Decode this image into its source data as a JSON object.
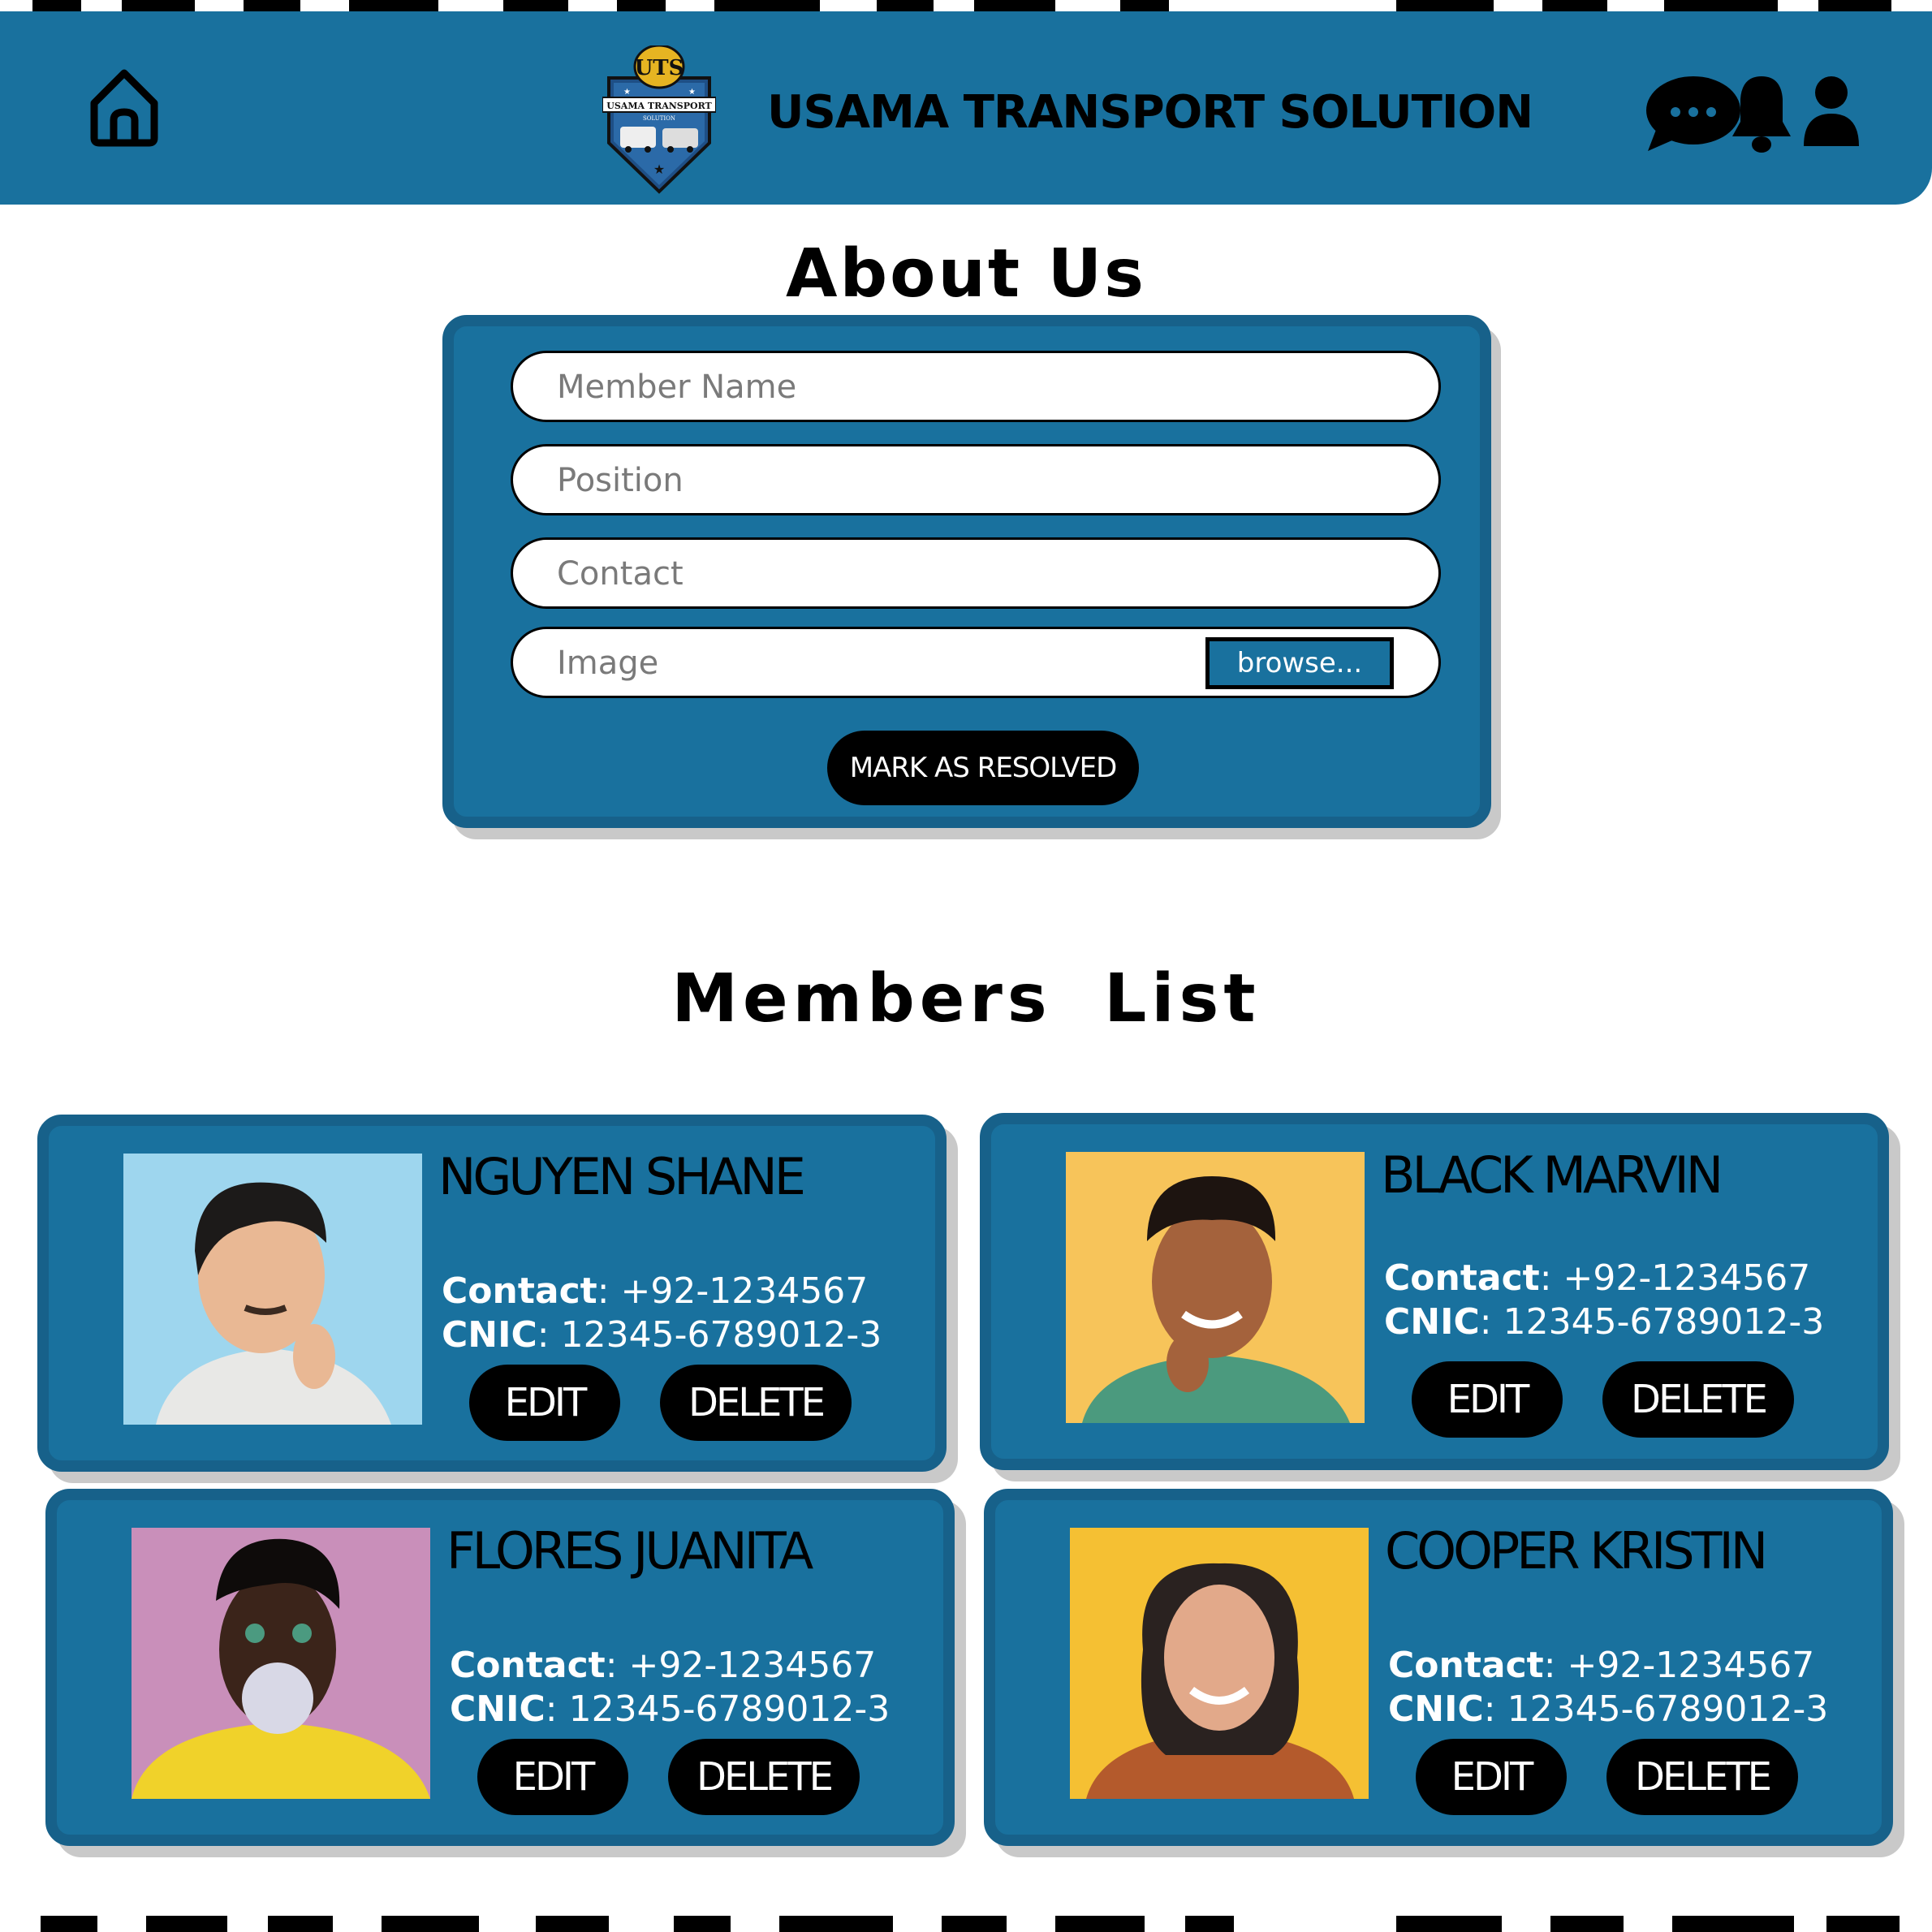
{
  "header": {
    "brand": "USAMA TRANSPORT SOLUTION",
    "logo_text": "UTS",
    "logo_banner": "USAMA TRANSPORT",
    "logo_sub": "SOLUTION",
    "icons": [
      "home-icon",
      "chat-icon",
      "bell-icon",
      "user-icon"
    ]
  },
  "about": {
    "title": "About Us",
    "fields": {
      "member_name_placeholder": "Member Name",
      "position_placeholder": "Position",
      "contact_placeholder": "Contact",
      "image_placeholder": "Image"
    },
    "browse_label": "browse...",
    "submit_label": "MARK AS RESOLVED"
  },
  "members": {
    "title": "Members  List",
    "contact_label": "Contact",
    "cnic_label": "CNIC",
    "edit_label": "EDIT",
    "delete_label": "DELETE",
    "items": [
      {
        "name": "NGUYEN SHANE",
        "contact": "+92-1234567",
        "cnic": "12345-6789012-3",
        "photo_bg": "#9ed6ee"
      },
      {
        "name": "BLACK MARVIN",
        "contact": "+92-1234567",
        "cnic": "12345-6789012-3",
        "photo_bg": "#f7c45a"
      },
      {
        "name": "FLORES JUANITA",
        "contact": "+92-1234567",
        "cnic": "12345-6789012-3",
        "photo_bg": "#c98fba"
      },
      {
        "name": "COOPER KRISTIN",
        "contact": "+92-1234567",
        "cnic": "12345-6789012-3",
        "photo_bg": "#f5c033"
      }
    ]
  },
  "colors": {
    "primary": "#19719e",
    "border": "#17618a",
    "shadow": "#c9c9c9",
    "button": "#000000"
  }
}
